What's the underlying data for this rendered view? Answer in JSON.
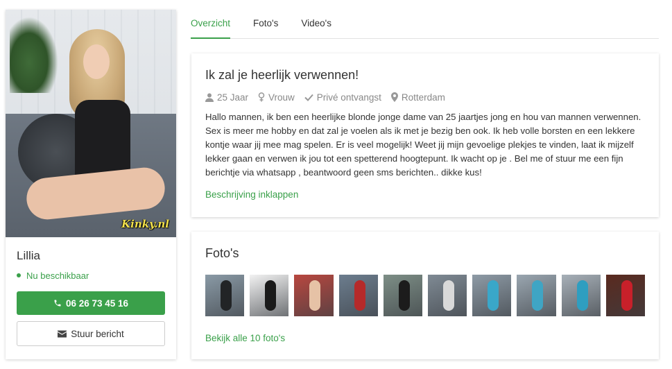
{
  "profile": {
    "name": "Lillia",
    "availability": "Nu beschikbaar",
    "phone": "06 26 73 45 16",
    "message_label": "Stuur bericht",
    "watermark": "Kinky.nl",
    "icons": {
      "status": "status-dot-icon",
      "phone": "phone-icon",
      "envelope": "envelope-icon"
    }
  },
  "tabs": [
    {
      "label": "Overzicht",
      "active": true
    },
    {
      "label": "Foto's",
      "active": false
    },
    {
      "label": "Video's",
      "active": false
    }
  ],
  "description_panel": {
    "title": "Ik zal je heerlijk verwennen!",
    "meta": {
      "age": "25 Jaar",
      "gender": "Vrouw",
      "reception": "Privé ontvangst",
      "city": "Rotterdam"
    },
    "text": "Hallo mannen, ik ben een heerlijke blonde jonge dame van 25 jaartjes jong en hou van mannen verwennen. Sex is meer me hobby en dat zal je voelen als ik met je bezig ben ook. Ik heb volle borsten en een lekkere kontje waar jij mee mag spelen. Er is veel mogelijk! Weet jij mijn gevoelige plekjes te vinden, laat ik mijzelf lekker gaan en verwen ik jou tot een spetterend hoogtepunt. Ik wacht op je . Bel me of stuur me een fijn berichtje via whatsapp , beantwoord geen sms berichten.. dikke kus!",
    "collapse_label": "Beschrijving inklappen"
  },
  "photos_panel": {
    "title": "Foto's",
    "view_all_label": "Bekijk alle 10 foto's",
    "thumbnails": [
      {
        "bg": "#8a9aa6",
        "fig": "#222426"
      },
      {
        "bg": "#f2f2f2",
        "fig": "#1a1a1a"
      },
      {
        "bg": "#b8473f",
        "fig": "#e6c2a6"
      },
      {
        "bg": "#6c7d8e",
        "fig": "#b52a2a"
      },
      {
        "bg": "#7d8e86",
        "fig": "#1c1c1c"
      },
      {
        "bg": "#7f8a94",
        "fig": "#d9d9d9"
      },
      {
        "bg": "#8e9ba6",
        "fig": "#3aa7c9"
      },
      {
        "bg": "#9aa6b0",
        "fig": "#3fa5c4"
      },
      {
        "bg": "#a7b0b8",
        "fig": "#2f9ec0"
      },
      {
        "bg": "#5a2a1f",
        "fig": "#c8202a"
      }
    ]
  },
  "colors": {
    "accent": "#3aa04a",
    "muted": "#888888",
    "text": "#333333"
  }
}
